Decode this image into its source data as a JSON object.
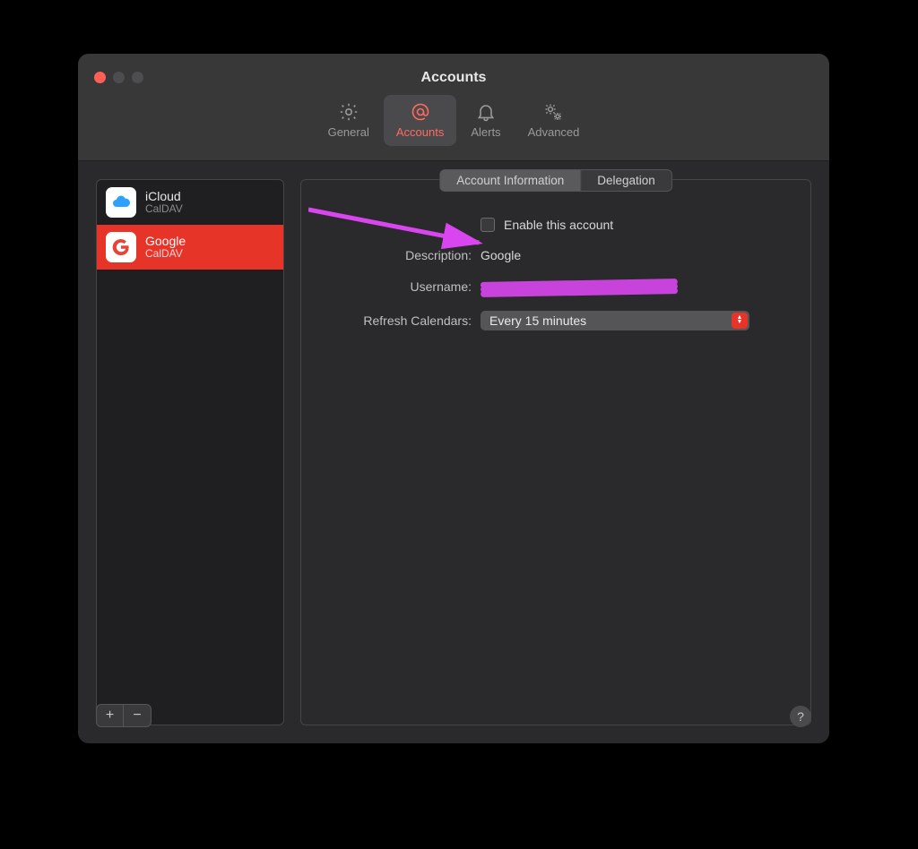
{
  "window": {
    "title": "Accounts"
  },
  "toolbar": {
    "items": [
      {
        "label": "General",
        "icon": "gear-icon",
        "active": false
      },
      {
        "label": "Accounts",
        "icon": "at-icon",
        "active": true
      },
      {
        "label": "Alerts",
        "icon": "bell-icon",
        "active": false
      },
      {
        "label": "Advanced",
        "icon": "gears-icon",
        "active": false
      }
    ]
  },
  "sidebar": {
    "accounts": [
      {
        "name": "iCloud",
        "subtype": "CalDAV",
        "selected": false
      },
      {
        "name": "Google",
        "subtype": "CalDAV",
        "selected": true
      }
    ],
    "add_label": "+",
    "remove_label": "−"
  },
  "detail": {
    "tabs": [
      {
        "label": "Account Information",
        "active": true
      },
      {
        "label": "Delegation",
        "active": false
      }
    ],
    "enable_label": "Enable this account",
    "enable_checked": false,
    "description_label": "Description:",
    "description_value": "Google",
    "username_label": "Username:",
    "username_value_redacted": true,
    "refresh_label": "Refresh Calendars:",
    "refresh_value": "Every 15 minutes"
  },
  "help_label": "?",
  "colors": {
    "accent": "#e63429",
    "annotation": "#d946ef"
  }
}
